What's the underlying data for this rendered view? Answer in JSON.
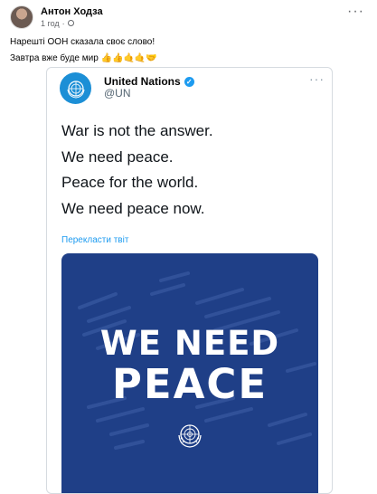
{
  "post": {
    "author": "Антон Ходза",
    "time": "1 год",
    "line1": "Нарешті ООН сказала своє слово!",
    "line2": "Завтра вже буде мир 👍👍🤙🤙🤝",
    "more_label": "···"
  },
  "tweet": {
    "name": "United Nations",
    "handle": "@UN",
    "more_label": "···",
    "lines": [
      "War is not the answer.",
      "We need peace.",
      "Peace for the world.",
      "We need peace now."
    ],
    "translate_label": "Перекласти твіт",
    "image": {
      "line1": "WE NEED",
      "line2": "PEACE",
      "background_color": "#1f3f87"
    }
  },
  "icons": [
    "avatar",
    "globe-icon",
    "verified-badge-icon",
    "un-emblem-icon"
  ]
}
